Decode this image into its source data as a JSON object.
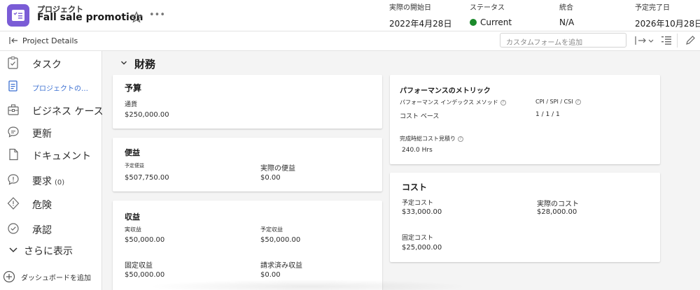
{
  "header": {
    "kicker": "プロジェクト",
    "title": "Fall sale promotion",
    "more": "•••",
    "meta": [
      {
        "label": "実際の開始日",
        "value": "2022年4月28日"
      },
      {
        "label": "ステータス",
        "value": "Current"
      },
      {
        "label": "統合",
        "value": "N/A"
      },
      {
        "label": "予定完了日",
        "value": "2026年10月28日"
      }
    ],
    "status_color": "#1b8a2b",
    "app_icon_color": "#7a5cd6"
  },
  "subbar": {
    "label": "Project Details",
    "custom_form_placeholder": "カスタムフォームを追加"
  },
  "sidebar": {
    "items": [
      {
        "label": "タスク",
        "icon": "checklist-icon"
      },
      {
        "label": "プロジェクトの…",
        "icon": "document-lines-icon",
        "active": true
      },
      {
        "label": "ビジネス ケース",
        "icon": "briefcase-icon"
      },
      {
        "label": "更新",
        "icon": "chat-bubble-icon"
      },
      {
        "label": "ドキュメント",
        "icon": "file-icon"
      },
      {
        "label": "要求",
        "count": "(0)",
        "icon": "request-bubble-icon"
      },
      {
        "label": "危険",
        "icon": "warning-diamond-icon"
      },
      {
        "label": "承認",
        "icon": "check-circle-icon"
      },
      {
        "label": "さらに表示",
        "icon": "chevron-down-icon"
      }
    ],
    "add_dashboard": "ダッシュボードを追加"
  },
  "main": {
    "section_title": "財務",
    "budget": {
      "title": "予算",
      "currency_label": "通貨",
      "currency_value": "$250,000.00"
    },
    "benefits": {
      "title": "便益",
      "planned_label": "予定便益",
      "planned_value": "$507,750.00",
      "actual_label": "実際の便益",
      "actual_value": "$0.00"
    },
    "revenue": {
      "title": "収益",
      "actual_label": "実収益",
      "actual_value": "$50,000.00",
      "planned_label": "予定収益",
      "planned_value": "$50,000.00",
      "fixed_label": "固定収益",
      "fixed_value": "$50,000.00",
      "billed_label": "請求済み収益",
      "billed_value": "$0.00"
    },
    "performance": {
      "title": "パフォーマンスのメトリック",
      "method_label": "パフォーマンス インデックス メソッド",
      "method_value": "コスト ベース",
      "cpi_label": "CPI / SPI / CSI",
      "cpi_value": "1 / 1 / 1",
      "eac_label": "完成時総コスト見積り",
      "eac_value": "240.0 Hrs"
    },
    "cost": {
      "title": "コスト",
      "planned_label": "予定コスト",
      "planned_value": "$33,000.00",
      "actual_label": "実際のコスト",
      "actual_value": "$28,000.00",
      "fixed_label": "固定コスト",
      "fixed_value": "$25,000.00"
    }
  }
}
